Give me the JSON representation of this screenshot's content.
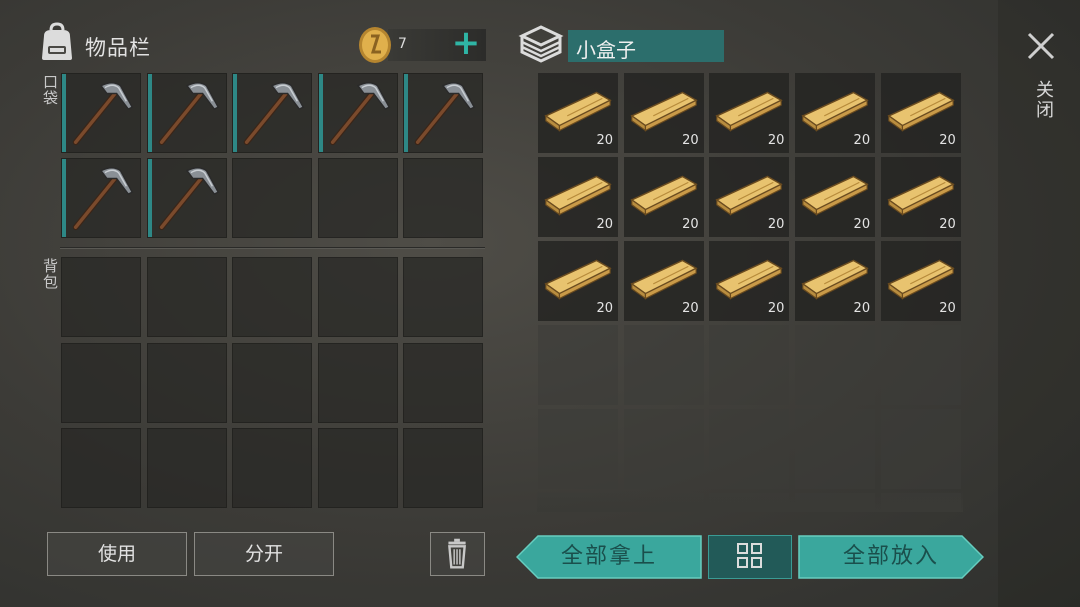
{
  "inventory": {
    "title": "物品栏",
    "coins": "7",
    "add_icon": "plus-icon",
    "pocket_label": "口袋",
    "backpack_label": "背包",
    "pocket_items": [
      {
        "item": "pickaxe"
      },
      {
        "item": "pickaxe"
      },
      {
        "item": "pickaxe"
      },
      {
        "item": "pickaxe"
      },
      {
        "item": "pickaxe"
      },
      {
        "item": "pickaxe"
      },
      {
        "item": "pickaxe"
      },
      {
        "item": ""
      },
      {
        "item": ""
      },
      {
        "item": ""
      }
    ],
    "backpack_slots": 15
  },
  "container": {
    "title": "小盒子",
    "icon": "box-icon",
    "items": [
      {
        "item": "wood-plank",
        "qty": "20"
      },
      {
        "item": "wood-plank",
        "qty": "20"
      },
      {
        "item": "wood-plank",
        "qty": "20"
      },
      {
        "item": "wood-plank",
        "qty": "20"
      },
      {
        "item": "wood-plank",
        "qty": "20"
      },
      {
        "item": "wood-plank",
        "qty": "20"
      },
      {
        "item": "wood-plank",
        "qty": "20"
      },
      {
        "item": "wood-plank",
        "qty": "20"
      },
      {
        "item": "wood-plank",
        "qty": "20"
      },
      {
        "item": "wood-plank",
        "qty": "20"
      },
      {
        "item": "wood-plank",
        "qty": "20"
      },
      {
        "item": "wood-plank",
        "qty": "20"
      },
      {
        "item": "wood-plank",
        "qty": "20"
      },
      {
        "item": "wood-plank",
        "qty": "20"
      },
      {
        "item": "wood-plank",
        "qty": "20"
      }
    ],
    "empty_slots": 15
  },
  "close": {
    "label": "关闭",
    "icon": "close-icon"
  },
  "buttons": {
    "use": "使用",
    "split": "分开",
    "trash_icon": "trash-icon",
    "take_all": "全部拿上",
    "sort_icon": "grid-icon",
    "put_all": "全部放入"
  },
  "colors": {
    "accent_teal": "#2fb5a5",
    "teal_button": "#3aa79d",
    "title_bar": "#2c6e6c",
    "background": "#3c3b37"
  }
}
